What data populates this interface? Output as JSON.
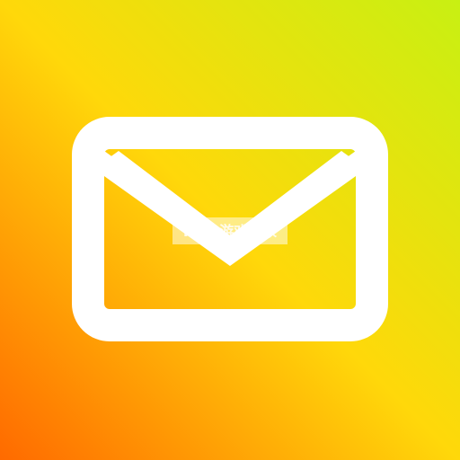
{
  "app_icon": {
    "icon": "mail-envelope-icon",
    "colors": {
      "gradient_top_right": "#C8F012",
      "gradient_middle": "#FFD80A",
      "gradient_bottom_left": "#FF6A00",
      "glyph": "#FFFFFF"
    }
  },
  "watermark": {
    "text": "K73 游戏之家",
    "colors": {
      "primary": "#FFFFFF"
    }
  }
}
